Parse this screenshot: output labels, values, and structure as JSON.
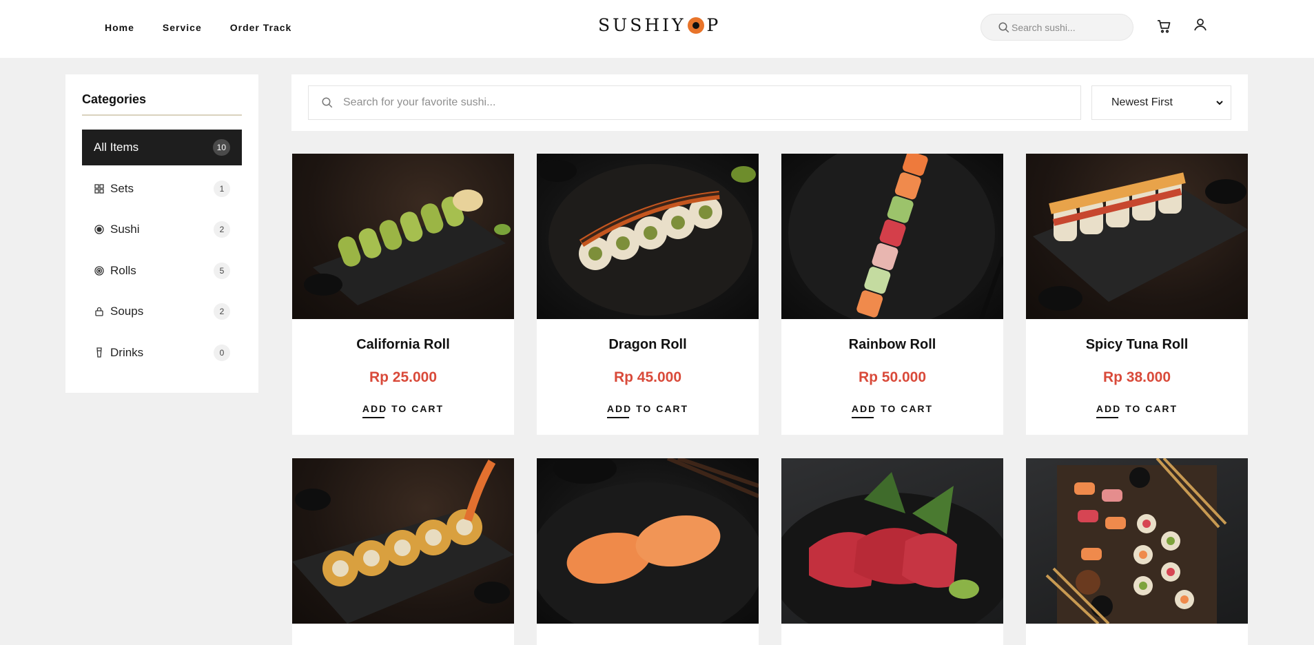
{
  "header": {
    "nav": [
      "Home",
      "Service",
      "Order Track"
    ],
    "logo_left": "SUSHIY",
    "logo_right": "P",
    "search_placeholder": "Search sushi..."
  },
  "sidebar": {
    "title": "Categories",
    "items": [
      {
        "label": "All Items",
        "count": "10",
        "icon": "all-icon",
        "active": true
      },
      {
        "label": "Sets",
        "count": "1",
        "icon": "grid-icon"
      },
      {
        "label": "Sushi",
        "count": "2",
        "icon": "target-icon"
      },
      {
        "label": "Rolls",
        "count": "5",
        "icon": "rings-icon"
      },
      {
        "label": "Soups",
        "count": "2",
        "icon": "bowl-icon"
      },
      {
        "label": "Drinks",
        "count": "0",
        "icon": "glass-icon"
      }
    ]
  },
  "toolbar": {
    "search_placeholder": "Search for your favorite sushi...",
    "sort_value": "Newest First"
  },
  "products": [
    {
      "name": "California Roll",
      "price": "Rp 25.000",
      "cta": "ADD TO CART"
    },
    {
      "name": "Dragon Roll",
      "price": "Rp 45.000",
      "cta": "ADD TO CART"
    },
    {
      "name": "Rainbow Roll",
      "price": "Rp 50.000",
      "cta": "ADD TO CART"
    },
    {
      "name": "Spicy Tuna Roll",
      "price": "Rp 38.000",
      "cta": "ADD TO CART"
    },
    {
      "name": "",
      "price": "",
      "cta": ""
    },
    {
      "name": "",
      "price": "",
      "cta": ""
    },
    {
      "name": "",
      "price": "",
      "cta": ""
    },
    {
      "name": "",
      "price": "",
      "cta": ""
    }
  ],
  "colors": {
    "accent_price": "#d94a3a",
    "active_category_bg": "#1e1e1e",
    "logo_mark": "#e8742a"
  }
}
